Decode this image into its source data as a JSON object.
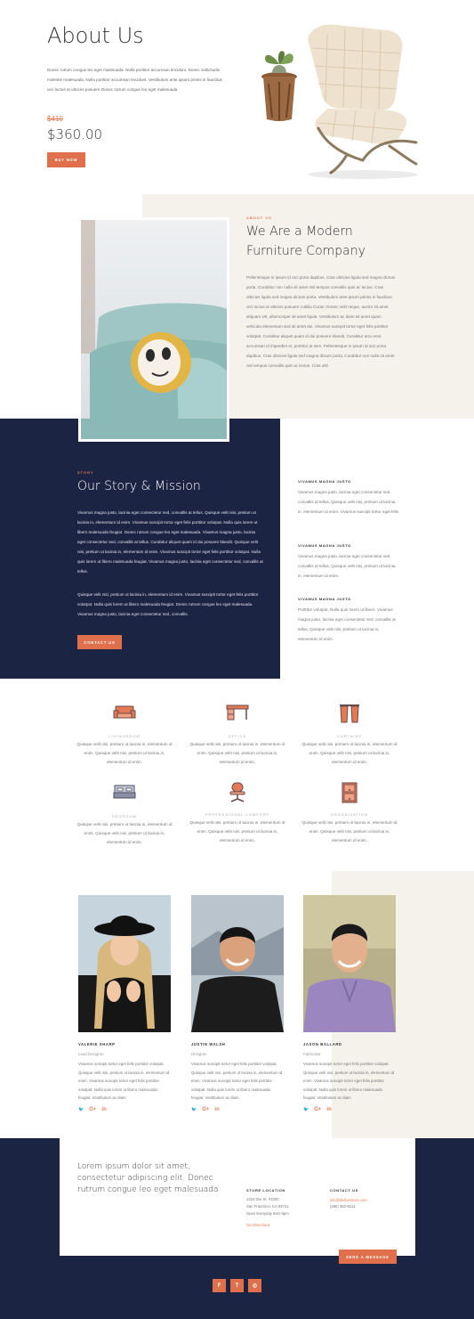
{
  "hero": {
    "title": "About Us",
    "description": "Donec rutrum congue leo eget malesuada. Nulla porttitor accumsan tincidunt. Donec sollicitudin molestie malesuada. Nulla porttitor accumsan tincidunt. Vestibulum ante ipsum primis in faucibus orci luctus et ultrices posuere Donec rutrum congue leo eget malesuada.",
    "old_price": "$410",
    "price": "$360.00",
    "buy_button": "Buy Now"
  },
  "about": {
    "eyebrow": "About Us",
    "title_line1": "We Are a Modern",
    "title_line2": "Furniture Company",
    "body": "Pellentesque in ipsum id orci porta dapibus. Cras ultricies ligula sed magna dictum porta. Curabitur non nulla sit amet nisl tempus convallis quis ac lectus. Cras ultricies ligula sed magna dictum porta. Vestibulum ante ipsum primis in faucibus orci luctus et ultrices posuere cubilia Curae; Donec velit neque, auctor sit amet aliquam vel, ullamcorper sit amet ligula. Vestibulum ac diam sit amet quam vehicula elementum sed sit amet dui. Vivamus suscipit tortor eget felis porttitor volutpat. Curabitur aliquet quam id dui posuere blandit. Curabitur arcu erat, accumsan id imperdiet et, porttitor at sem. Pellentesque in ipsum id orci porta dapibus. Cras ultricies ligula sed magna dictum porta. Curabitur non nulla sit amet nisl tempus convallis quis ac lectus. Cras ultri"
  },
  "story": {
    "eyebrow": "Story",
    "title": "Our Story & Mission",
    "para1": "Vivamus magna justo, lacinia eget consectetur sed, convallis at tellus. Quisque velit nisi, pretium ut lacinia in, elementum id enim. Vivamus suscipit tortor eget felis porttitor volutpat. Nulla quis lorem ut libero malesuada feugiat. Donec rutrum congue leo eget malesuada. Vivamus magna justo, lacinia eget consectetur sed, convallis at tellus. Curabitur aliquet quam id dui posuere blandit. Quisque velit nisi, pretium ut lacinia in, elementum id enim. Vivamus suscipit tortor eget felis porttitor volutpat. Nulla quis lorem ut libero malesuada feugiat. Vivamus magna justo, lacinia eget consectetur sed, convallis at tellus.",
    "para2": "Quisque velit nisi, pretium ut lacinia in, elementum id enim. Vivamus suscipit tortor eget felis porttitor volutpat. Nulla quis lorem ut libero malesuada feugiat. Donec rutrum congue leo eget malesuada. Vivamus magna justo, lacinia eget consectetur sed, convallis.",
    "button": "Contact Us",
    "side": [
      {
        "title": "Vivamus Magna Justo",
        "text": "Vivamus magna justo, lacinia eget consectetur sed, convallis at tellus. Quisque velit nisi, pretium ut lacinia in, elementum id enim. Vivamus suscipit tortor eget felis"
      },
      {
        "title": "Vivamus Magna Justo",
        "text": "Vivamus magna justo, lacinia eget consectetur sed, convallis at tellus. Quisque velit nisi, pretium ut lacinia in, elementum id enim."
      },
      {
        "title": "Vivamus Magna Justo",
        "text": "Porttitor volutpat. Nulla quis lorem ut libero. Vivamus magna justo, lacinia eget consectetur sed, convallis at tellus. Quisque velit nisi, pretium ut lacinia in, elementum id enim."
      }
    ]
  },
  "features": [
    {
      "title": "Livingroom",
      "icon": "sofa-icon",
      "text": "Quisque velit nisi, pretium ut lacinia in, elementum id enim. Quisque velit nisi, pretium ut lacinia in, elementum id enim."
    },
    {
      "title": "Office",
      "icon": "desk-icon",
      "text": "Quisque velit nisi, pretium ut lacinia in, elementum id enim. Quisque velit nisi, pretium ut lacinia in, elementum id enim."
    },
    {
      "title": "Curtains",
      "icon": "curtains-icon",
      "text": "Quisque velit nisi, pretium ut lacinia in, elementum id enim. Quisque velit nisi, pretium ut lacinia in, elementum id enim."
    },
    {
      "title": "Bedroom",
      "icon": "bed-icon",
      "text": "Quisque velit nisi, pretium ut lacinia in, elementum id enim. Quisque velit nisi, pretium ut lacinia in, elementum id enim."
    },
    {
      "title": "Professional Comfort",
      "icon": "office-chair-icon",
      "text": "Quisque velit nisi, pretium ut lacinia in, elementum id enim. Quisque velit nisi, pretium ut lacinia in, elementum id enim."
    },
    {
      "title": "Organization",
      "icon": "cabinet-icon",
      "text": "Quisque velit nisi, pretium ut lacinia in, elementum id enim. Quisque velit nisi, pretium ut lacinia in, elementum id enim."
    }
  ],
  "team": [
    {
      "name": "Valerie Sharp",
      "role": "Lead Designer",
      "bio": "Vivamus suscipit tortor eget felis porttitor volutpat. Quisque velit nisi, pretium ut lacinia in, elementum id enim. Vivamus suscipit tortor eget felis porttitor volutpat. Nulla quis lorem ut libero malesuada feugiat. Vestibulum ac diam"
    },
    {
      "name": "Justin Walsh",
      "role": "Designer",
      "bio": "Vivamus suscipit tortor eget felis porttitor volutpat. Quisque velit nisi, pretium ut lacinia in, elementum id enim. Vivamus suscipit tortor eget felis porttitor volutpat. Nulla quis lorem ut libero malesuada feugiat. Vestibulum ac diam"
    },
    {
      "name": "Jason Ballard",
      "role": "Fabricator",
      "bio": "Vivamus suscipit tortor eget felis porttitor volutpat. Quisque velit nisi, pretium ut lacinia in, elementum id enim. Vivamus suscipit tortor eget felis porttitor volutpat. Nulla quis lorem ut libero malesuada feugiat. Vestibulum ac diam"
    }
  ],
  "social_glyphs": {
    "twitter": "🐦",
    "gplus": "G+",
    "linkedin": "in"
  },
  "contact": {
    "lead": "Lorem ipsum dolor sit amet, consectetur adipiscing elit. Donec rutrum congue leo eget malesuada",
    "store_title": "Store Location",
    "store_line1": "1234 Divi St. #1000",
    "store_line2": "San Francisco, CA 93721",
    "store_line3": "Open Everyday 8am-5pm",
    "directions": "Get Directions",
    "contact_title": "Contact Us",
    "email": "info@divifurniture.com",
    "phone": "(255) 352-6211",
    "button": "Send a Message"
  },
  "footer_icons": {
    "facebook": "f",
    "twitter": "t",
    "instagram": "◎"
  },
  "colors": {
    "navy": "#1c2444",
    "accent": "#e0704c",
    "cream": "#f5f2ec"
  }
}
